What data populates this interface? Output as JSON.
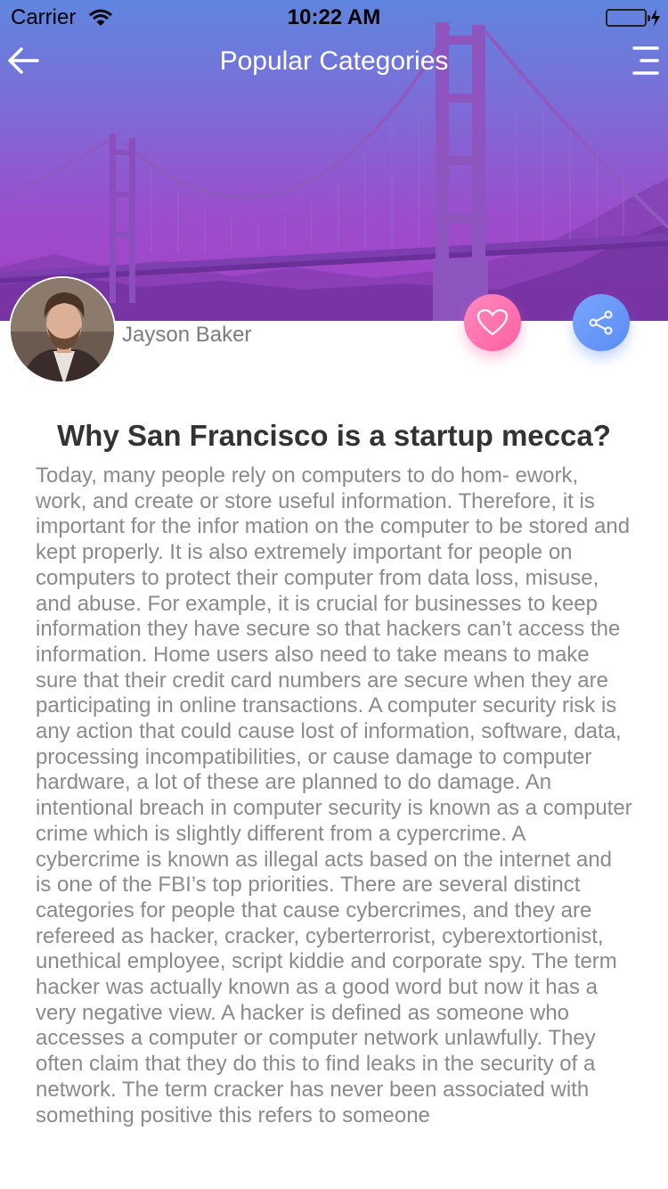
{
  "status_bar": {
    "carrier": "Carrier",
    "time": "10:22 AM",
    "battery_level": 1.0,
    "battery_color": "#4cd964"
  },
  "nav": {
    "title": "Popular Categories",
    "back_icon": "arrow-left-icon",
    "menu_icon": "hamburger-menu-icon"
  },
  "hero": {
    "gradient_colors": [
      "#5f86de",
      "#9a4fcd"
    ]
  },
  "author": {
    "name": "Jayson Baker"
  },
  "actions": {
    "like_icon": "heart-icon",
    "share_icon": "share-icon",
    "like_color": "#ff6fae",
    "share_color": "#6a98f8"
  },
  "article": {
    "title": "Why San Francisco is a startup mecca?",
    "body": "Today, many people rely on computers to do hom- ework, work, and create or store useful information. Therefore, it is important for the infor mation on the computer to be stored and kept properly. It is also extremely important for people on computers to protect their computer from data loss, misuse, and abuse. For example, it is crucial for businesses to keep information they have secure so that hackers can’t access the information. Home users also need to take means to make sure that their credit card numbers are secure when they are participating in online transactions. A computer security risk is any action that could cause lost of information, software, data, processing incompatibilities, or cause damage to computer hardware,  a lot of these are planned to do damage. An intentional breach in computer security is known as a computer crime which is slightly different from a cypercrime. A cybercrime is known as illegal acts based on the internet and is one of the FBI’s top priorities. There are several distinct categories for people that cause cybercrimes, and they are refereed as hacker, cracker, cyberterrorist, cyberextortionist, unethical employee, script kiddie and corporate spy. The term hacker was actually known as a good word but now it has a very negative view. A hacker is defined as someone who accesses a computer or computer network unlawfully. They often claim that they do this to find leaks in the security of a network. The term cracker has never been associated with something positive this refers to someone"
  }
}
